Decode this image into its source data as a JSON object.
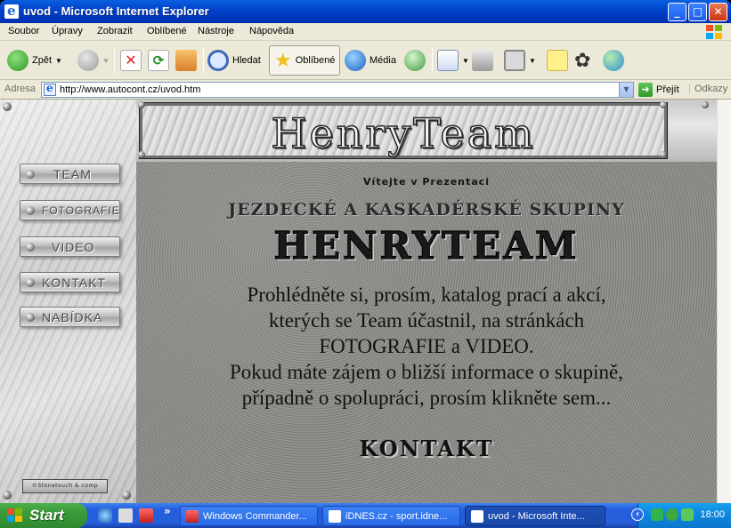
{
  "window": {
    "title": "uvod - Microsoft Internet Explorer",
    "controls": {
      "minimize": "_",
      "maximize": "□",
      "close": "✕"
    }
  },
  "menu": [
    "Soubor",
    "Úpravy",
    "Zobrazit",
    "Oblíbené",
    "Nástroje",
    "Nápověda"
  ],
  "toolbar": {
    "back": "Zpět",
    "search": "Hledat",
    "favorites": "Oblíbené",
    "media": "Média"
  },
  "address": {
    "label": "Adresa",
    "url": "http://www.autocont.cz/uvod.htm",
    "go": "Přejít",
    "links": "Odkazy"
  },
  "site": {
    "banner_name": "HenryTeam",
    "nav": [
      {
        "label": "Team"
      },
      {
        "label": "Fotografie"
      },
      {
        "label": "Video"
      },
      {
        "label": "Kontakt"
      },
      {
        "label": "Nabídka"
      }
    ],
    "copyright": "©Stonetouch & comp",
    "welcome": "Vítejte v Prezentaci",
    "subtitle": "JEZDECKÉ A KASKADÉRSKÉ SKUPINY",
    "big_name": "HENRYTEAM",
    "paragraph": [
      "Prohlédněte si, prosím, katalog prací a akcí,",
      "kterých se  Team  účastnil, na stránkách",
      "FOTOGRAFIE a VIDEO.",
      "Pokud máte zájem o bližší informace o skupině,",
      "případně o spolupráci, prosím klikněte sem..."
    ],
    "contact_link": "KONTAKT"
  },
  "taskbar": {
    "start": "Start",
    "quicklaunch_more": "»",
    "tasks": [
      {
        "label": "Windows Commander..."
      },
      {
        "label": "iDNES.cz - sport.idne..."
      },
      {
        "label": "uvod - Microsoft Inte..."
      }
    ],
    "clock": "18:00"
  },
  "colors": {
    "titlebar": "#0041c9",
    "taskbar": "#245edb",
    "start": "#3a9a3a",
    "chrome": "#ece9d8"
  }
}
